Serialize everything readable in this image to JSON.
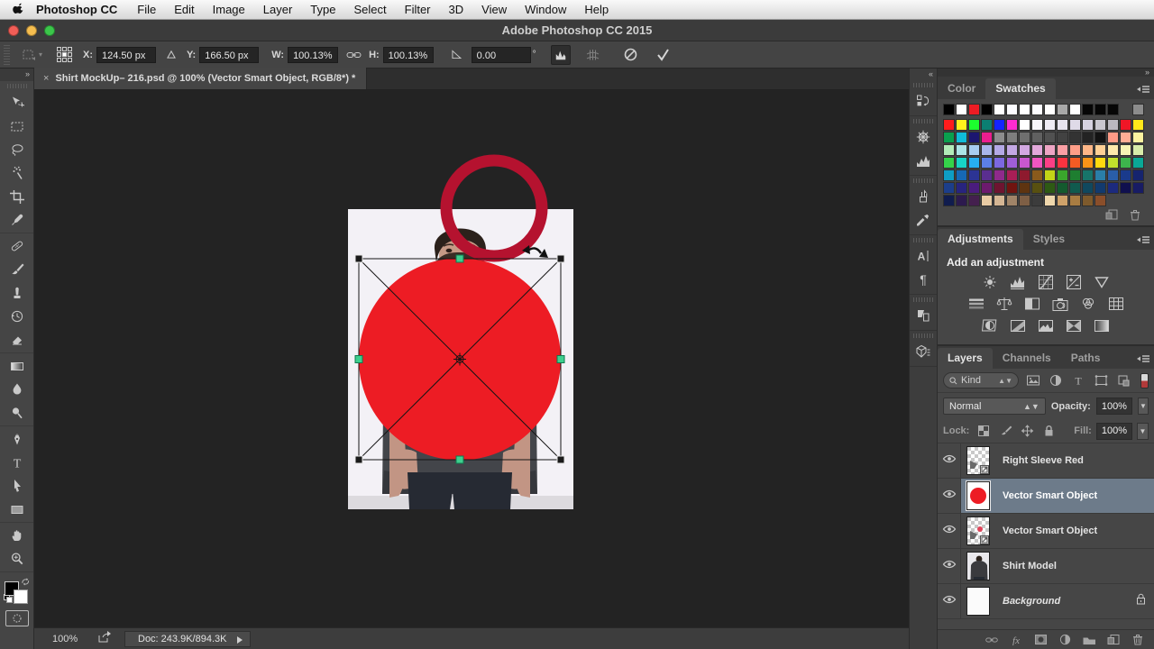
{
  "menu_bar": {
    "apple_icon": "apple-logo",
    "items": [
      "Photoshop CC",
      "File",
      "Edit",
      "Image",
      "Layer",
      "Type",
      "Select",
      "Filter",
      "3D",
      "View",
      "Window",
      "Help"
    ]
  },
  "title_bar": {
    "title": "Adobe Photoshop CC 2015"
  },
  "options_bar": {
    "x_label": "X:",
    "x_value": "124.50 px",
    "y_label": "Y:",
    "y_value": "166.50 px",
    "w_label": "W:",
    "w_value": "100.13%",
    "h_label": "H:",
    "h_value": "100.13%",
    "angle_value": "0.00",
    "degree_symbol": "°"
  },
  "document_tab": {
    "close": "×",
    "title": "Shirt MockUp– 216.psd @ 100% (Vector Smart Object, RGB/8*) *"
  },
  "toolbar": {
    "collapse": "»",
    "tool_groups": [
      [
        "move-tool",
        "marquee-tool",
        "lasso-tool",
        "magic-wand-tool",
        "crop-tool",
        "eyedropper-tool"
      ],
      [
        "healing-brush-tool",
        "brush-tool",
        "clone-stamp-tool",
        "history-brush-tool",
        "eraser-tool"
      ],
      [
        "gradient-tool",
        "blur-tool",
        "dodge-tool"
      ],
      [
        "pen-tool",
        "type-tool",
        "path-select-tool",
        "shape-tool"
      ],
      [
        "hand-tool",
        "zoom-tool"
      ]
    ]
  },
  "dock": {
    "collapse": "«",
    "groups": [
      [
        "history"
      ],
      [
        "navigator",
        "histogram"
      ],
      [
        "brush-presets",
        "tool-presets"
      ],
      [
        "character",
        "paragraph"
      ],
      [
        "clone-source"
      ],
      [
        "threed"
      ]
    ]
  },
  "panels_collapse": "»",
  "swatches_panel": {
    "tabs": [
      "Color",
      "Swatches"
    ],
    "active_tab": "Swatches",
    "recent_swatches": [
      "#000000",
      "#ffffff",
      "#ed1c24",
      "#000000",
      "#ffffff",
      "#fcfcff",
      "#ffffff",
      "#fcfcff",
      "#ffffff",
      "#a8a8a8",
      "#ffffff",
      "#060606",
      "#060606",
      "#060606",
      "spacer",
      "#8c8c8c"
    ],
    "swatch_rows": [
      [
        "#ff1c1c",
        "#fff21c",
        "#1cff2e",
        "#0b7f72",
        "#1424ff",
        "#ff2bd1",
        "#ffffff",
        "#f7f5fa",
        "#efecf4",
        "#e7e3ee",
        "#dfdae8",
        "#d6d2e0",
        "#c9c7cf",
        "#bab8c0",
        "#f01626",
        "#ffe81a"
      ],
      [
        "#0aa04e",
        "#10bcd8",
        "#1c1670",
        "#ec1e8e",
        "#8d8d8d",
        "#7e7e7e",
        "#6f6f6f",
        "#606060",
        "#515151",
        "#424242",
        "#333333",
        "#232323",
        "#121212",
        "#ff9a86",
        "#ffad94",
        "#fcf3a0"
      ],
      [
        "#b2ecb8",
        "#ace4e6",
        "#a8cdf0",
        "#a9b6ea",
        "#b4a9e6",
        "#c3a8e4",
        "#d2a8e2",
        "#e2a8da",
        "#eea5c4",
        "#fa9fa4",
        "#ff9e88",
        "#ffb687",
        "#ffd095",
        "#ffe9ac",
        "#f6f4b4",
        "#d8edaa"
      ],
      [
        "#35d24a",
        "#17d3c5",
        "#27aef0",
        "#5c7fe8",
        "#7c68e0",
        "#9f5ed6",
        "#c957cf",
        "#f056c0",
        "#fb3f86",
        "#fa3340",
        "#f55b24",
        "#fa9418",
        "#ffd90f",
        "#c3e02c",
        "#3db54c",
        "#0aa896"
      ],
      [
        "#0e9ec4",
        "#1668b4",
        "#2c3494",
        "#5a2e90",
        "#8f2a8c",
        "#a81e56",
        "#8e1a2e",
        "#8a5a1c",
        "#c2d416",
        "#3aa62c",
        "#1e7e30",
        "#17746a",
        "#2a7ea8",
        "#2a5ea8",
        "#1a3a8c",
        "#16246e"
      ],
      [
        "#1c3e8a",
        "#28247e",
        "#4a1c7e",
        "#6c1a6e",
        "#6e1430",
        "#701410",
        "#5e3410",
        "#585010",
        "#2e5a14",
        "#145a2e",
        "#105a4e",
        "#10485e",
        "#123a6e",
        "#1c2a7e",
        "#10104e",
        "#181c64"
      ],
      [
        "#101c4e",
        "#2c1a4e",
        "#44204e",
        "#e8cba4",
        "#d5b694",
        "#a08468",
        "#7e5f45",
        "#3c3c3c",
        "#efd7ac",
        "#cfa26a",
        "#a87c42",
        "#7e5a2c",
        "#8a4e2a"
      ]
    ]
  },
  "adjustments_panel": {
    "tabs": [
      "Adjustments",
      "Styles"
    ],
    "active_tab": "Adjustments",
    "heading": "Add an adjustment",
    "icon_rows": [
      [
        "brightness-contrast",
        "levels",
        "curves",
        "exposure",
        "vibrance"
      ],
      [
        "hue-saturation",
        "color-balance",
        "black-white",
        "photo-filter",
        "channel-mixer",
        "color-lookup"
      ],
      [
        "invert",
        "posterize",
        "threshold",
        "gradient-map",
        "selective-color"
      ]
    ]
  },
  "layers_panel": {
    "tabs": [
      "Layers",
      "Channels",
      "Paths"
    ],
    "active_tab": "Layers",
    "filter_label": "Kind",
    "filter_icons": [
      "pixel-filter",
      "adjustment-filter",
      "type-filter",
      "shape-filter",
      "smart-filter"
    ],
    "blend_mode": "Normal",
    "opacity_label": "Opacity:",
    "opacity_value": "100%",
    "lock_label": "Lock:",
    "lock_icons": [
      "lock-transparency",
      "lock-paint",
      "lock-move",
      "lock-all"
    ],
    "fill_label": "Fill:",
    "fill_value": "100%",
    "layers": [
      {
        "name": "Right Sleeve Red",
        "thumb": "checker",
        "selected": false,
        "locked": false,
        "italic": false
      },
      {
        "name": "Vector Smart Object",
        "thumb": "red-circle",
        "selected": true,
        "locked": false,
        "italic": false
      },
      {
        "name": "Vector Smart Object",
        "thumb": "checker-dot",
        "selected": false,
        "locked": false,
        "italic": false
      },
      {
        "name": "Shirt Model",
        "thumb": "photo",
        "selected": false,
        "locked": false,
        "italic": false
      },
      {
        "name": "Background",
        "thumb": "white",
        "selected": false,
        "locked": true,
        "italic": true
      }
    ],
    "footer_icons": [
      "link-layers",
      "layer-effects",
      "add-layer-mask",
      "new-adjustment-layer",
      "new-group",
      "new-layer",
      "delete-layer"
    ]
  },
  "status_bar": {
    "zoom": "100%",
    "doc_info": "Doc: 243.9K/894.3K"
  },
  "canvas": {
    "colors": {
      "circle_fill": "#ed1c24",
      "ring_stroke": "#b5122f",
      "handle_accent": "#3ecf8e",
      "bbox_line": "#151515"
    }
  }
}
